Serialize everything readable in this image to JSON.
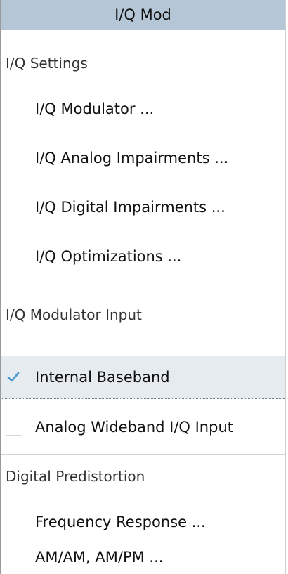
{
  "title": "I/Q Mod",
  "sections": {
    "iq_settings": {
      "label": "I/Q Settings",
      "items": [
        "I/Q Modulator ...",
        "I/Q Analog Impairments ...",
        "I/Q Digital Impairments ...",
        "I/Q Optimizations ..."
      ]
    },
    "iq_modulator_input": {
      "label": "I/Q Modulator Input",
      "options": [
        {
          "label": "Internal Baseband",
          "checked": true
        },
        {
          "label": "Analog Wideband I/Q Input",
          "checked": false
        }
      ]
    },
    "digital_predistortion": {
      "label": "Digital Predistortion",
      "items": [
        "Frequency Response ...",
        "AM/AM, AM/PM ..."
      ]
    }
  },
  "colors": {
    "title_bg": "#b5c7d7",
    "selected_bg": "#e6ebef",
    "check_color": "#4a97d0"
  }
}
